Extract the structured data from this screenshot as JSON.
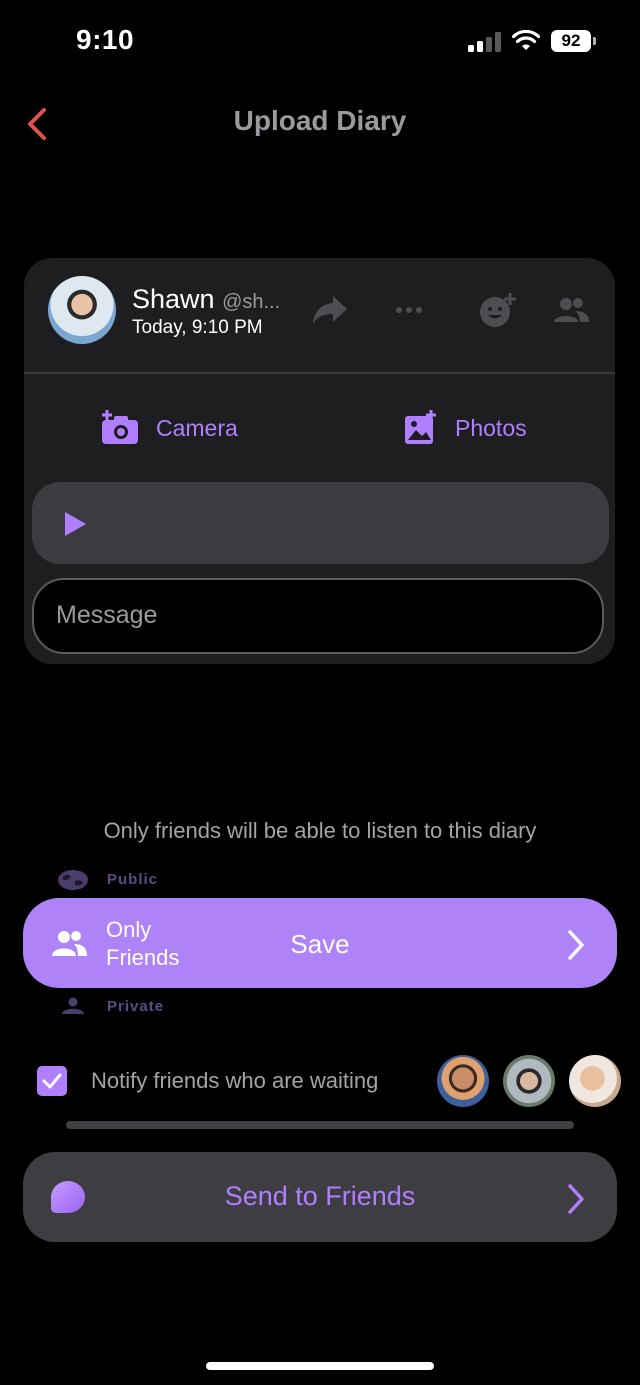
{
  "status_bar": {
    "time": "9:10",
    "battery": "92"
  },
  "header": {
    "title": "Upload Diary"
  },
  "post": {
    "user_name": "Shawn",
    "user_handle": "@sh...",
    "timestamp": "Today, 9:10 PM",
    "camera_label": "Camera",
    "photos_label": "Photos",
    "message_placeholder": "Message"
  },
  "privacy": {
    "note": "Only friends will be able to listen to this diary",
    "options": [
      "Public",
      "Only Friends",
      "Private"
    ],
    "selected_line1": "Only",
    "selected_line2": "Friends",
    "save_label": "Save"
  },
  "notify": {
    "label": "Notify friends who are waiting",
    "checked": true
  },
  "send": {
    "label": "Send to Friends"
  },
  "colors": {
    "accent": "#b07fff",
    "save_bar": "#ae83f7",
    "card": "#1e1e20",
    "back_arrow": "#e2524c"
  }
}
